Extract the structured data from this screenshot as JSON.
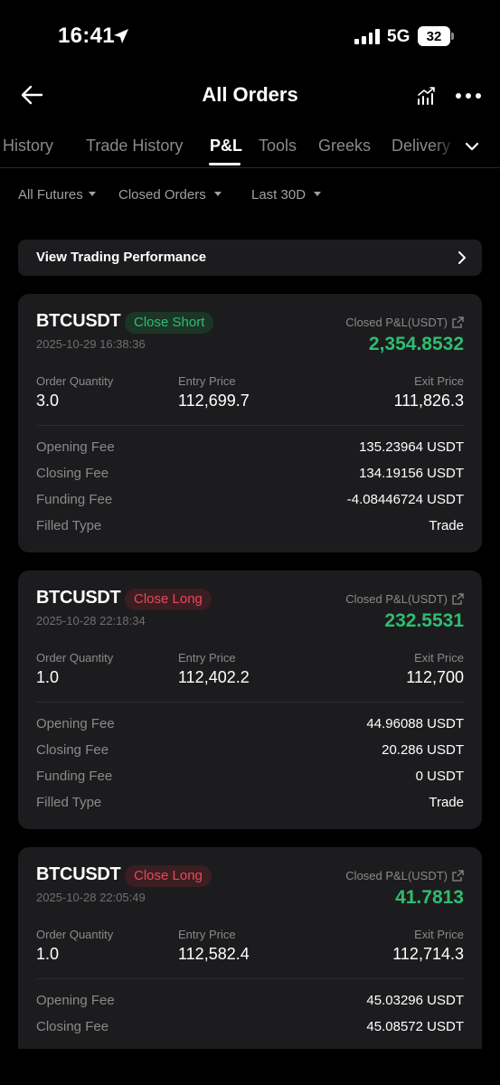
{
  "status_bar": {
    "time": "16:41",
    "network": "5G",
    "battery": "32"
  },
  "header": {
    "title": "All Orders"
  },
  "tabs": [
    {
      "label": "r History",
      "active": false
    },
    {
      "label": "Trade History",
      "active": false
    },
    {
      "label": "P&L",
      "active": true
    },
    {
      "label": "Tools",
      "active": false
    },
    {
      "label": "Greeks",
      "active": false
    },
    {
      "label": "Delivery",
      "active": false
    }
  ],
  "filters": {
    "futures": "All Futures",
    "orders": "Closed Orders",
    "period": "Last 30D"
  },
  "performance": {
    "label": "View Trading Performance"
  },
  "labels": {
    "pnl": "Closed P&L(USDT)",
    "order_quantity": "Order Quantity",
    "entry_price": "Entry Price",
    "exit_price": "Exit Price",
    "opening_fee": "Opening Fee",
    "closing_fee": "Closing Fee",
    "funding_fee": "Funding Fee",
    "filled_type": "Filled Type"
  },
  "orders": [
    {
      "symbol": "BTCUSDT",
      "side": "Close Short",
      "timestamp": "2025-10-29 16:38:36",
      "pnl": "2,354.8532",
      "quantity": "3.0",
      "entry_price": "112,699.7",
      "exit_price": "111,826.3",
      "opening_fee": "135.23964 USDT",
      "closing_fee": "134.19156 USDT",
      "funding_fee": "-4.08446724 USDT",
      "filled_type": "Trade"
    },
    {
      "symbol": "BTCUSDT",
      "side": "Close Long",
      "timestamp": "2025-10-28 22:18:34",
      "pnl": "232.5531",
      "quantity": "1.0",
      "entry_price": "112,402.2",
      "exit_price": "112,700",
      "opening_fee": "44.96088 USDT",
      "closing_fee": "20.286 USDT",
      "funding_fee": "0 USDT",
      "filled_type": "Trade"
    },
    {
      "symbol": "BTCUSDT",
      "side": "Close Long",
      "timestamp": "2025-10-28 22:05:49",
      "pnl": "41.7813",
      "quantity": "1.0",
      "entry_price": "112,582.4",
      "exit_price": "112,714.3",
      "opening_fee": "45.03296 USDT",
      "closing_fee": "45.08572 USDT"
    }
  ],
  "colors": {
    "profit": "#2ebd70",
    "loss": "#e8495a",
    "card": "#1c1c1e"
  }
}
